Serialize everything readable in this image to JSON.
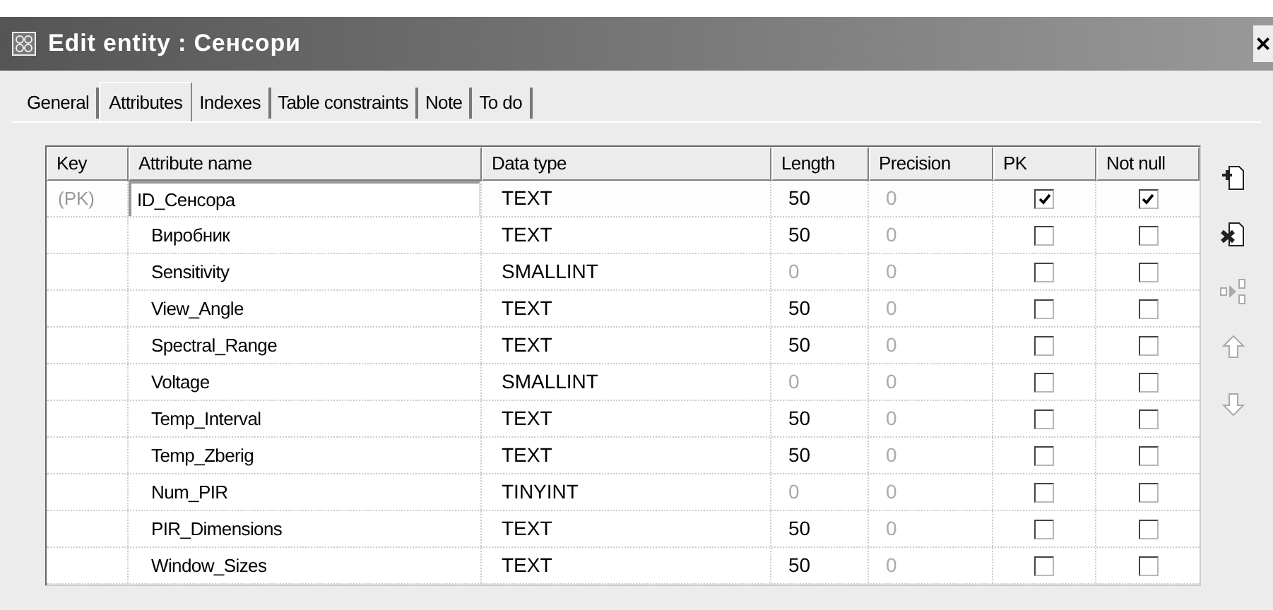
{
  "window": {
    "title": "Edit entity : Сенсори",
    "close": "×"
  },
  "tabs": [
    {
      "label": "General",
      "selected": false
    },
    {
      "label": "Attributes",
      "selected": true
    },
    {
      "label": "Indexes",
      "selected": false
    },
    {
      "label": "Table constraints",
      "selected": false
    },
    {
      "label": "Note",
      "selected": false
    },
    {
      "label": "To do",
      "selected": false
    }
  ],
  "table": {
    "columns": [
      "Key",
      "Attribute name",
      "Data type",
      "Length",
      "Precision",
      "PK",
      "Not null"
    ],
    "rows": [
      {
        "key": "(PK)",
        "name": "ID_Сенсора",
        "type": "TEXT",
        "length": "50",
        "length_enabled": true,
        "precision": "0",
        "pk": true,
        "not_null": true,
        "selected": true
      },
      {
        "name": "Виробник",
        "type": "TEXT",
        "length": "50",
        "length_enabled": true,
        "precision": "0",
        "pk": false,
        "not_null": false,
        "selected": false
      },
      {
        "name": "Sensitivity",
        "type": "SMALLINT",
        "length": "0",
        "length_enabled": false,
        "precision": "0",
        "pk": false,
        "not_null": false,
        "selected": false
      },
      {
        "name": "View_Angle",
        "type": "TEXT",
        "length": "50",
        "length_enabled": true,
        "precision": "0",
        "pk": false,
        "not_null": false,
        "selected": false
      },
      {
        "name": "Spectral_Range",
        "type": "TEXT",
        "length": "50",
        "length_enabled": true,
        "precision": "0",
        "pk": false,
        "not_null": false,
        "selected": false
      },
      {
        "name": "Voltage",
        "type": "SMALLINT",
        "length": "0",
        "length_enabled": false,
        "precision": "0",
        "pk": false,
        "not_null": false,
        "selected": false
      },
      {
        "name": "Temp_Interval",
        "type": "TEXT",
        "length": "50",
        "length_enabled": true,
        "precision": "0",
        "pk": false,
        "not_null": false,
        "selected": false
      },
      {
        "name": "Temp_Zberig",
        "type": "TEXT",
        "length": "50",
        "length_enabled": true,
        "precision": "0",
        "pk": false,
        "not_null": false,
        "selected": false
      },
      {
        "name": "Num_PIR",
        "type": "TINYINT",
        "length": "0",
        "length_enabled": false,
        "precision": "0",
        "pk": false,
        "not_null": false,
        "selected": false
      },
      {
        "name": "PIR_Dimensions",
        "type": "TEXT",
        "length": "50",
        "length_enabled": true,
        "precision": "0",
        "pk": false,
        "not_null": false,
        "selected": false
      },
      {
        "name": "Window_Sizes",
        "type": "TEXT",
        "length": "50",
        "length_enabled": true,
        "precision": "0",
        "pk": false,
        "not_null": false,
        "selected": false
      }
    ]
  },
  "toolbar": [
    {
      "kind": "add",
      "disabled": false
    },
    {
      "kind": "delete",
      "disabled": false
    },
    {
      "kind": "move",
      "disabled": true
    },
    {
      "kind": "up",
      "disabled": true
    },
    {
      "kind": "down",
      "disabled": true
    }
  ]
}
